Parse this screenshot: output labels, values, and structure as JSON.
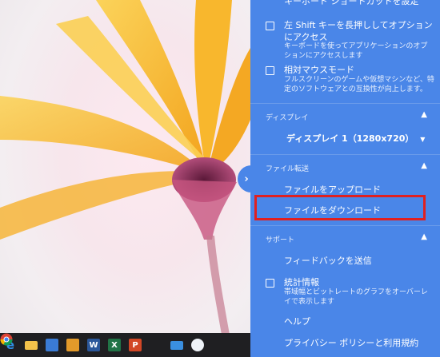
{
  "panel": {
    "top_cut_text": "キーボード ショートカットを設定",
    "option_key": {
      "title": "左 Shift キーを長押ししてオプションにアクセス",
      "desc": "キーボードを使ってアプリケーションのオプションにアクセスします",
      "checked": false
    },
    "relative_mouse": {
      "title": "相対マウスモード",
      "desc": "フルスクリーンのゲームや仮想マシンなど、特定のソフトウェアとの互換性が向上します。",
      "checked": false
    },
    "display_section": {
      "label": "ディスプレイ",
      "selected": "ディスプレイ 1（1280x720）"
    },
    "file_section": {
      "label": "ファイル転送",
      "upload": "ファイルをアップロード",
      "download": "ファイルをダウンロード"
    },
    "support_section": {
      "label": "サポート",
      "feedback": "フィードバックを送信",
      "stats": {
        "title": "統計情報",
        "desc": "帯域幅とビットレートのグラフをオーバーレイで表示します",
        "checked": false
      },
      "help": "ヘルプ",
      "privacy": "プライバシー ポリシーと利用規約"
    }
  },
  "taskbar": {
    "icons": [
      "edge-icon",
      "file-explorer-icon",
      "store-icon",
      "media-icon",
      "word-icon",
      "excel-icon",
      "powerpoint-icon",
      "chrome-icon",
      "mail-icon",
      "paint-icon"
    ]
  },
  "colors": {
    "panel_bg": "#4a86e8",
    "highlight": "#e02020",
    "taskbar": "#1f1f22"
  }
}
